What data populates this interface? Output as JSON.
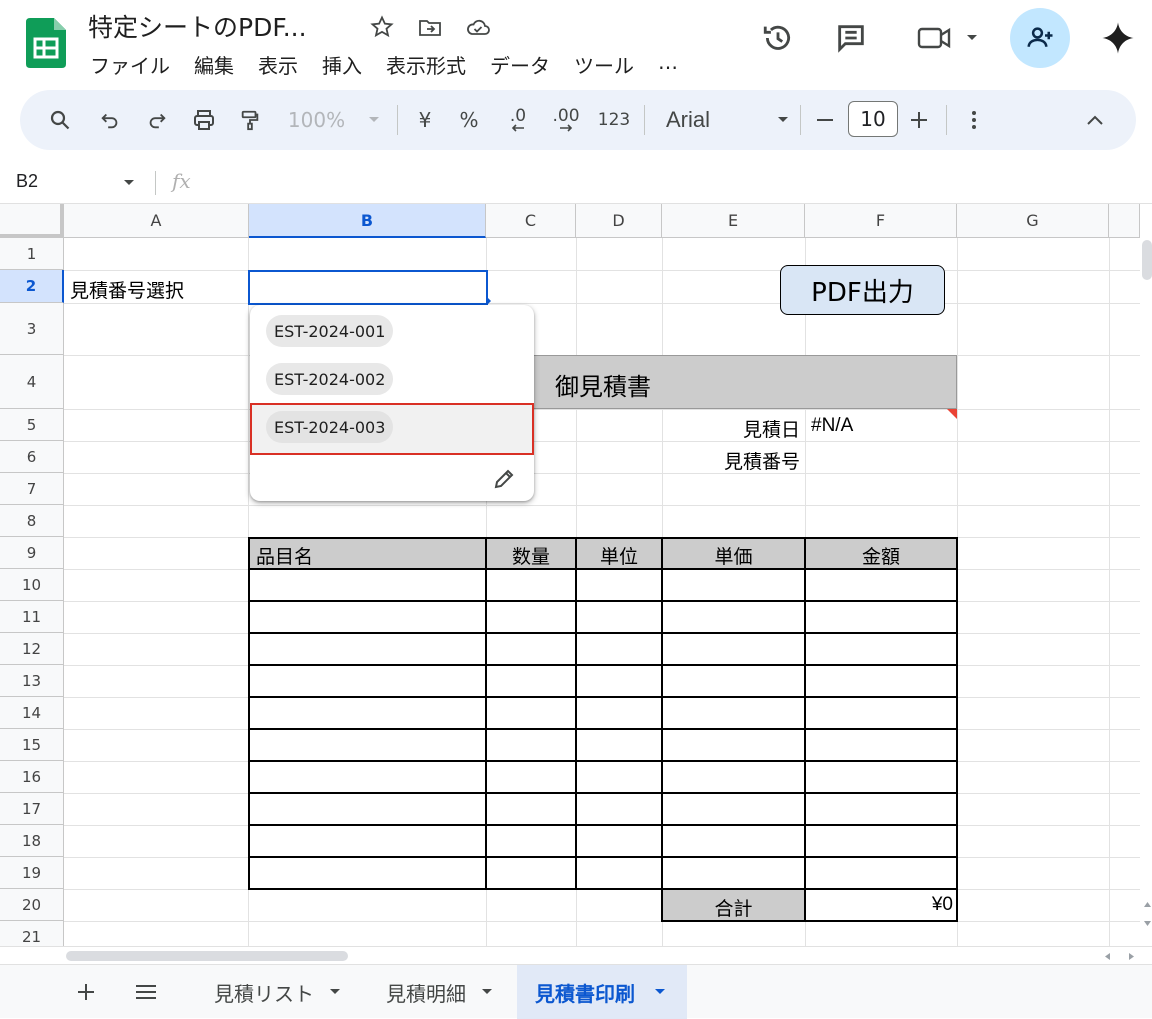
{
  "header": {
    "title": "特定シートのPDF...",
    "menu": [
      "ファイル",
      "編集",
      "表示",
      "挿入",
      "表示形式",
      "データ",
      "ツール",
      "…"
    ]
  },
  "toolbar": {
    "zoom": "100%",
    "currency": "¥",
    "percent": "%",
    "dec_decrease": ".0",
    "dec_increase": ".00",
    "number_format": "123",
    "font": "Arial",
    "font_size": "10"
  },
  "formula_bar": {
    "name_box": "B2",
    "fx": "fx"
  },
  "columns": [
    "A",
    "B",
    "C",
    "D",
    "E",
    "F",
    "G"
  ],
  "rows": [
    "1",
    "2",
    "3",
    "4",
    "5",
    "6",
    "7",
    "8",
    "9",
    "10",
    "11",
    "12",
    "13",
    "14",
    "15",
    "16",
    "17",
    "18",
    "19",
    "20",
    "21"
  ],
  "cells": {
    "a2": "見積番号選択",
    "title": "御見積書",
    "date_label": "見積日",
    "date_value": "#N/A",
    "number_label": "見積番号",
    "table_headers": [
      "品目名",
      "数量",
      "単位",
      "単価",
      "金額"
    ],
    "total_label": "合計",
    "total_value": "¥0"
  },
  "pdf_button": "PDF出力",
  "dropdown": {
    "options": [
      "EST-2024-001",
      "EST-2024-002",
      "EST-2024-003"
    ],
    "highlighted_index": 2
  },
  "sheet_tabs": [
    {
      "label": "見積リスト",
      "active": false
    },
    {
      "label": "見積明細",
      "active": false
    },
    {
      "label": "見積書印刷",
      "active": true
    }
  ],
  "colors": {
    "accent": "#0b57d0",
    "selected_header": "#d3e3fd",
    "share_bg": "#c2e7ff",
    "highlight_border": "#d93025"
  }
}
